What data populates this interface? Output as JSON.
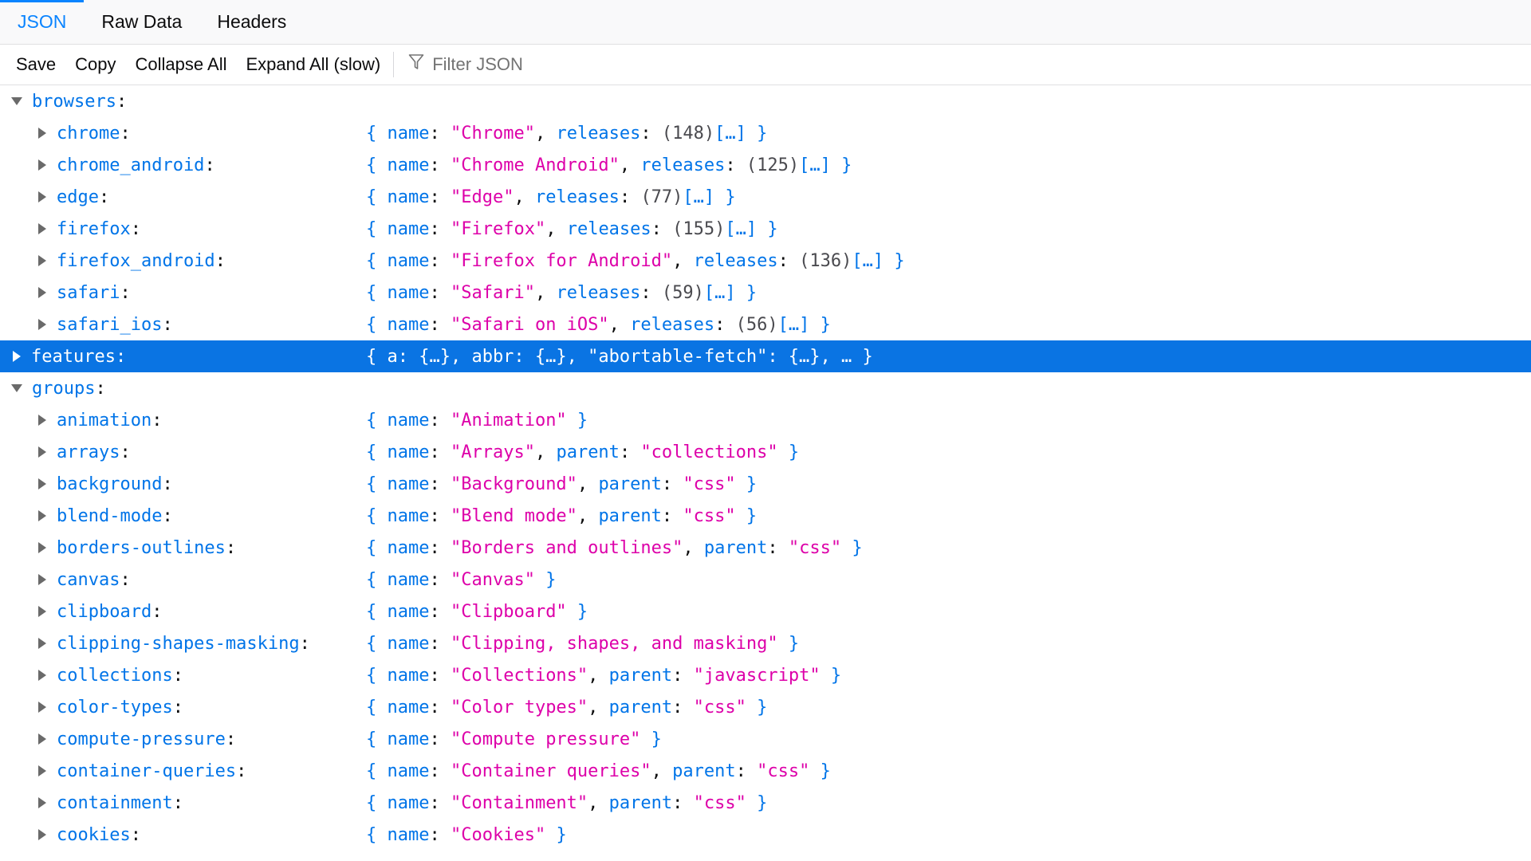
{
  "tabs": [
    {
      "label": "JSON",
      "active": true
    },
    {
      "label": "Raw Data",
      "active": false
    },
    {
      "label": "Headers",
      "active": false
    }
  ],
  "toolbar": {
    "save_label": "Save",
    "copy_label": "Copy",
    "collapse_label": "Collapse All",
    "expand_label": "Expand All (slow)",
    "filter_placeholder": "Filter JSON",
    "filter_icon": "funnel-icon"
  },
  "colors": {
    "accent": "#0a84ff",
    "selected_row": "#0a74e3",
    "key": "#0074e8",
    "string": "#dd00a9"
  },
  "tree": {
    "browsers_key": "browsers",
    "browsers": [
      {
        "key": "chrome",
        "name": "\"Chrome\"",
        "count": "(148)"
      },
      {
        "key": "chrome_android",
        "name": "\"Chrome Android\"",
        "count": "(125)"
      },
      {
        "key": "edge",
        "name": "\"Edge\"",
        "count": "(77)"
      },
      {
        "key": "firefox",
        "name": "\"Firefox\"",
        "count": "(155)"
      },
      {
        "key": "firefox_android",
        "name": "\"Firefox for Android\"",
        "count": "(136)"
      },
      {
        "key": "safari",
        "name": "\"Safari\"",
        "count": "(59)"
      },
      {
        "key": "safari_ios",
        "name": "\"Safari on iOS\"",
        "count": "(56)"
      }
    ],
    "features_key": "features",
    "features_preview": "{ a: {…}, abbr: {…}, \"abortable-fetch\": {…}, … }",
    "groups_key": "groups",
    "groups": [
      {
        "key": "animation",
        "name": "\"Animation\"",
        "parent": null
      },
      {
        "key": "arrays",
        "name": "\"Arrays\"",
        "parent": "\"collections\""
      },
      {
        "key": "background",
        "name": "\"Background\"",
        "parent": "\"css\""
      },
      {
        "key": "blend-mode",
        "name": "\"Blend mode\"",
        "parent": "\"css\""
      },
      {
        "key": "borders-outlines",
        "name": "\"Borders and outlines\"",
        "parent": "\"css\""
      },
      {
        "key": "canvas",
        "name": "\"Canvas\"",
        "parent": null
      },
      {
        "key": "clipboard",
        "name": "\"Clipboard\"",
        "parent": null
      },
      {
        "key": "clipping-shapes-masking",
        "name": "\"Clipping, shapes, and masking\"",
        "parent": null
      },
      {
        "key": "collections",
        "name": "\"Collections\"",
        "parent": "\"javascript\""
      },
      {
        "key": "color-types",
        "name": "\"Color types\"",
        "parent": "\"css\""
      },
      {
        "key": "compute-pressure",
        "name": "\"Compute pressure\"",
        "parent": null
      },
      {
        "key": "container-queries",
        "name": "\"Container queries\"",
        "parent": "\"css\""
      },
      {
        "key": "containment",
        "name": "\"Containment\"",
        "parent": "\"css\""
      },
      {
        "key": "cookies",
        "name": "\"Cookies\"",
        "parent": null
      }
    ],
    "labels": {
      "name": "name",
      "releases": "releases",
      "parent": "parent",
      "ellipsis": "[…]"
    }
  }
}
